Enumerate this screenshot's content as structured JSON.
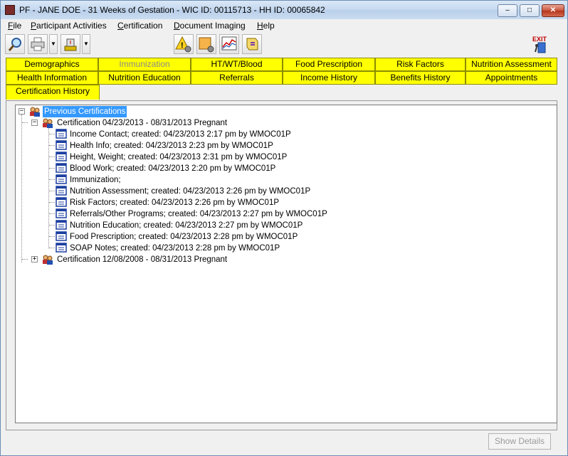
{
  "window": {
    "title": "PF - JANE DOE - 31 Weeks of Gestation - WIC ID: 00115713 - HH ID: 00065842",
    "min_label": "–",
    "max_label": "□",
    "close_label": "✕"
  },
  "menu": [
    {
      "u": "F",
      "rest": "ile"
    },
    {
      "u": "P",
      "rest": "articipant Activities"
    },
    {
      "u": "C",
      "rest": "ertification"
    },
    {
      "u": "D",
      "rest": "ocument Imaging"
    },
    {
      "u": "H",
      "rest": "elp"
    }
  ],
  "toolbar": {
    "icons": [
      "magnifier-icon",
      "printer-icon",
      "dropdown-arrow-icon",
      "scale-icon",
      "dropdown-arrow-icon",
      "alert-gear-icon",
      "note-gear-icon",
      "chart-icon",
      "scroll-icon",
      "exit-icon"
    ],
    "dropdown_glyph": "▼",
    "exit_label": "EXIT"
  },
  "tabs": {
    "row1": [
      "Demographics",
      "Immunization",
      "HT/WT/Blood",
      "Food Prescription",
      "Risk Factors",
      "Nutrition Assessment"
    ],
    "row2": [
      "Health Information",
      "Nutrition Education",
      "Referrals",
      "Income History",
      "Benefits History",
      "Appointments"
    ],
    "row3": [
      "Certification History"
    ],
    "active": "Certification History",
    "disabled": [
      "Immunization"
    ],
    "color": "#ffff00"
  },
  "tree": {
    "root": "Previous Certifications",
    "expanded_glyph": "−",
    "collapsed_glyph": "+",
    "cert1": {
      "label": "Certification 04/23/2013 - 08/31/2013 Pregnant",
      "items": [
        "Income Contact; created: 04/23/2013 2:17 pm by WMOC01P",
        "Health Info; created: 04/23/2013 2:23 pm by WMOC01P",
        "Height, Weight; created: 04/23/2013 2:31 pm by WMOC01P",
        "Blood Work; created: 04/23/2013 2:20 pm by WMOC01P",
        "Immunization;",
        "Nutrition Assessment; created: 04/23/2013 2:26 pm by WMOC01P",
        "Risk Factors; created: 04/23/2013 2:26 pm by WMOC01P",
        "Referrals/Other Programs; created: 04/23/2013 2:27 pm by WMOC01P",
        "Nutrition Education; created: 04/23/2013 2:27 pm by WMOC01P",
        "Food Prescription; created: 04/23/2013 2:28 pm by WMOC01P",
        "SOAP Notes; created: 04/23/2013 2:28 pm by WMOC01P"
      ]
    },
    "cert2": {
      "label": "Certification 12/08/2008 - 08/31/2013 Pregnant"
    },
    "selection_color": "#3399ff"
  },
  "buttons": {
    "show_details": "Show Details"
  }
}
